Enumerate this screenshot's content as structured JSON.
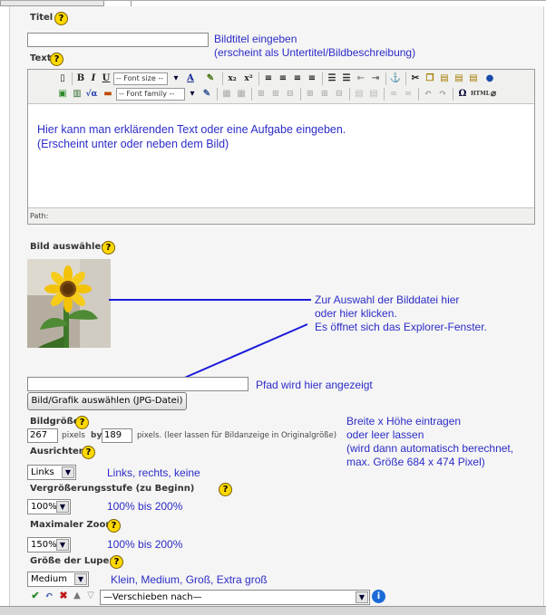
{
  "title_field": {
    "label": "Titel",
    "help": "?",
    "note": "Bildtitel eingeben\n(erscheint als Untertitel/Bildbeschreibung)"
  },
  "text_field": {
    "label": "Text",
    "help": "?"
  },
  "editor": {
    "font_size_placeholder": "-- Font size --",
    "font_family_placeholder": "-- Font family --",
    "content": "Hier kann man erklärenden Text oder eine Aufgabe eingeben.\n(Erscheint unter oder neben dem Bild)",
    "path_label": "Path:"
  },
  "image_select": {
    "label": "Bild auswählen:",
    "help": "?",
    "note": "Zur Auswahl der Bilddatei hier\noder hier klicken.\nEs öffnet sich das Explorer-Fenster.",
    "path_note": "Pfad wird hier angezeigt",
    "button_label": "Bild/Grafik auswählen (JPG-Datei)"
  },
  "image_size": {
    "label": "Bildgröße",
    "help": "?",
    "width": "267",
    "pixels_by": "pixels",
    "by": "by",
    "height": "189",
    "hint": "pixels. (leer lassen für Bildanzeige in Originalgröße)",
    "note": "Breite x Höhe eintragen\noder leer lassen\n(wird dann automatisch berechnet,\nmax. Größe 684 x 474 Pixel)"
  },
  "align": {
    "label": "Ausrichten:",
    "help": "?",
    "value": "Links",
    "note": "Links, rechts, keine"
  },
  "zoom_start": {
    "label": "Vergrößerungsstufe (zu Beginn)",
    "help": "?",
    "value": "100%",
    "note": "100% bis 200%"
  },
  "zoom_max": {
    "label": "Maximaler Zoom",
    "help": "?",
    "value": "150%",
    "note": "100% bis 200%"
  },
  "lens_size": {
    "label": "Größe der Lupe:",
    "help": "?",
    "value": "Medium",
    "note": "Klein, Medium, Groß, Extra groß"
  },
  "move_select": {
    "value": "—Verschieben nach—"
  },
  "colors": {
    "note": "#2c2cc8",
    "help": "#ffd800"
  }
}
